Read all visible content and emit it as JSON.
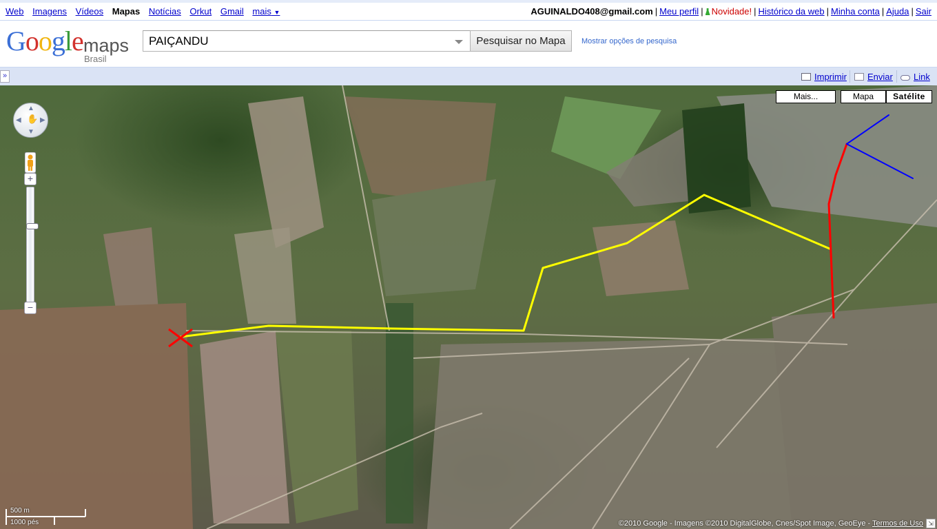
{
  "topnav": {
    "links": [
      "Web",
      "Imagens",
      "Vídeos"
    ],
    "current": "Mapas",
    "links2": [
      "Notícias",
      "Orkut",
      "Gmail"
    ],
    "more": "mais",
    "user": "AGUINALDO408@gmail.com",
    "profile": "Meu perfil",
    "novidade": "Novidade!",
    "history": "Histórico da web",
    "account": "Minha conta",
    "help": "Ajuda",
    "signout": "Sair"
  },
  "logo": {
    "google": "Google",
    "maps": "maps",
    "country": "Brasil"
  },
  "search": {
    "value": "PAIÇANDU",
    "button": "Pesquisar no Mapa",
    "options": "Mostrar opções de pesquisa"
  },
  "toolbar": {
    "expand": "»",
    "print": "Imprimir",
    "send": "Enviar",
    "link": "Link"
  },
  "map": {
    "buttons": {
      "more": "Mais...",
      "map": "Mapa",
      "satellite": "Satélite"
    },
    "scale": {
      "metric": "500 m",
      "imperial": "1000 pés"
    },
    "copyright": "©2010 Google - Imagens ©2010 DigitalGlobe, Cnes/Spot Image, GeoEye - ",
    "terms": "Termos de Uso",
    "colors": {
      "route_yellow": "#ffff00",
      "route_red": "#ff0000",
      "route_blue": "#0000ff"
    }
  }
}
